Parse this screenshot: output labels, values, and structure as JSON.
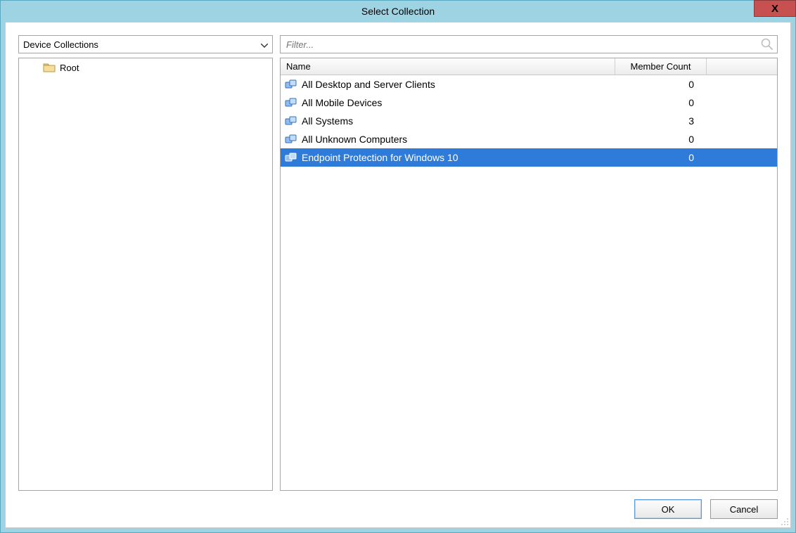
{
  "window": {
    "title": "Select Collection",
    "close_glyph": "X"
  },
  "dropdown": {
    "selected": "Device Collections",
    "arrow": "⌄"
  },
  "filter": {
    "placeholder": "Filter..."
  },
  "columns": {
    "name": "Name",
    "member_count": "Member Count"
  },
  "tree": {
    "root_label": "Root"
  },
  "rows": [
    {
      "name": "All Desktop and Server Clients",
      "count": "0",
      "selected": false
    },
    {
      "name": "All Mobile Devices",
      "count": "0",
      "selected": false
    },
    {
      "name": "All Systems",
      "count": "3",
      "selected": false
    },
    {
      "name": "All Unknown Computers",
      "count": "0",
      "selected": false
    },
    {
      "name": "Endpoint Protection for Windows 10",
      "count": "0",
      "selected": true
    }
  ],
  "buttons": {
    "ok": "OK",
    "cancel": "Cancel"
  }
}
